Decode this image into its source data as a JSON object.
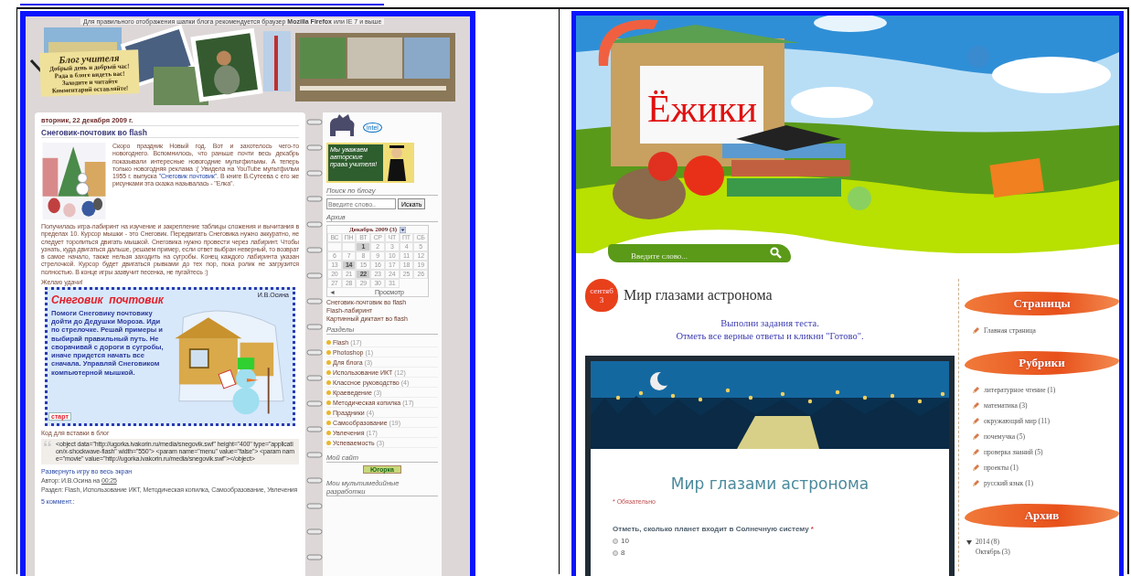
{
  "left_blog": {
    "header": {
      "notice": "Для правильного отображения шапки блога рекомендуется браузер **Mozilla Firefox** или IE 7 и выше",
      "note_title": "Блог учителя",
      "note_lines": [
        "Добрый день и добрый час!",
        "Рада в блоге видеть вас!",
        "Заходите и читайте",
        "Комментарий оставляйте!"
      ]
    },
    "post": {
      "date": "вторник, 22 декабря 2009 г.",
      "title": "Снеговик-почтовик во flash",
      "paragraphs": [
        [
          {
            "kind": "text",
            "text": "Скоро праздник Новый год. Вот и захотелось чего-то новогоднего. Вспомнилось, что раньше почти весь декабрь показывали интересные новогодние мультфильмы. А теперь только новогодняя реклама :( Увидела на YouTube мультфильм 1955 г. выпуска "
          },
          {
            "kind": "link",
            "text": "\"Снеговик почтовик\""
          },
          {
            "kind": "text",
            "text": ". В книге В.Сутеева с его же рисунками эта сказка называлась - \"Елка\"."
          }
        ],
        [
          {
            "kind": "text",
            "text": "Получилась игра-лабиринт на изучение и закрепление таблицы сложения и вычитания в пределах 10. Курсор мышки - это Снеговик. Передвигать Снеговика нужно аккуратно, не следует торопиться двигать мышкой. Снеговика нужно провести через лабиринт. Чтобы узнать, куда двигаться дальше, решаем пример, если ответ выбран неверный, то возврат в самое начало, также нельзя заходить на сугробы. Конец каждого лабиринта указан стрелочкой. Курсор будет двигаться рывками до тех пор, пока ролик не загрузится полностью. В конце игры зазвучит песенка, не пугайтесь :)"
          }
        ]
      ],
      "wish": "Желаю удачи!",
      "game": {
        "author": "И.В.Осина",
        "title": "Снеговик  почтовик",
        "text": "Помоги Снеговику почтовику дойти до Дедушки Мороза. Иди по стрелочке. Решай примеры и выбирай правильный путь. Не сворачивай с дороги в сугробы, иначе придется начать все сначала. Управляй Снеговиком компьютерной мышкой.",
        "start_button": "старт"
      },
      "embed_label": "Код для вставки в блог",
      "embed_code": "<object data=\"http://ugorka.ivakorin.ru/media/snegovik.swf\" height=\"400\" type=\"application/x-shockwave-flash\" width=\"550\"> <param name=\"menu\" value=\"false\"> <param name=\"movie\" value=\"http://ugorka.ivakorin.ru/media/snegovik.swf\"></object>",
      "fullscreen_link": "Развернуть игру во весь экран",
      "author_line": "Автор: И.В.Осина на",
      "author_time": "00:25",
      "labels_line": "Раздел: Flash, Использование ИКТ, Методическая копилка, Самообразование, Увлечения",
      "comments": "5 коммент.:"
    },
    "sidebar": {
      "partner_logo": "intel",
      "chalkboard": "Мы уважаем авторские права учителя!",
      "search": {
        "title": "Поиск по блогу",
        "placeholder": "Введите слово..",
        "button": "Искать"
      },
      "archive": {
        "title": "Архив",
        "month": "Декабрь 2009 (3)",
        "weekdays": [
          "ВС",
          "ПН",
          "ВТ",
          "СР",
          "ЧТ",
          "ПТ",
          "СБ"
        ],
        "days": [
          {
            "kind": "blank"
          },
          {
            "kind": "blank"
          },
          {
            "kind": "day",
            "label": "1",
            "has_post": true
          },
          {
            "kind": "day",
            "label": "2",
            "has_post": false
          },
          {
            "kind": "day",
            "label": "3",
            "has_post": false
          },
          {
            "kind": "day",
            "label": "4",
            "has_post": false
          },
          {
            "kind": "day",
            "label": "5",
            "has_post": false
          },
          {
            "kind": "day",
            "label": "6",
            "has_post": false
          },
          {
            "kind": "day",
            "label": "7",
            "has_post": false
          },
          {
            "kind": "day",
            "label": "8",
            "has_post": false
          },
          {
            "kind": "day",
            "label": "9",
            "has_post": false
          },
          {
            "kind": "day",
            "label": "10",
            "has_post": false
          },
          {
            "kind": "day",
            "label": "11",
            "has_post": false
          },
          {
            "kind": "day",
            "label": "12",
            "has_post": false
          },
          {
            "kind": "day",
            "label": "13",
            "has_post": false
          },
          {
            "kind": "day",
            "label": "14",
            "has_post": true
          },
          {
            "kind": "day",
            "label": "15",
            "has_post": false
          },
          {
            "kind": "day",
            "label": "16",
            "has_post": false
          },
          {
            "kind": "day",
            "label": "17",
            "has_post": false
          },
          {
            "kind": "day",
            "label": "18",
            "has_post": false
          },
          {
            "kind": "day",
            "label": "19",
            "has_post": false
          },
          {
            "kind": "day",
            "label": "20",
            "has_post": false
          },
          {
            "kind": "day",
            "label": "21",
            "has_post": false
          },
          {
            "kind": "day",
            "label": "22",
            "has_post": true
          },
          {
            "kind": "day",
            "label": "23",
            "has_post": false
          },
          {
            "kind": "day",
            "label": "24",
            "has_post": false
          },
          {
            "kind": "day",
            "label": "25",
            "has_post": false
          },
          {
            "kind": "day",
            "label": "26",
            "has_post": false
          },
          {
            "kind": "day",
            "label": "27",
            "has_post": false
          },
          {
            "kind": "day",
            "label": "28",
            "has_post": false
          },
          {
            "kind": "day",
            "label": "29",
            "has_post": false
          },
          {
            "kind": "day",
            "label": "30",
            "has_post": false
          },
          {
            "kind": "day",
            "label": "31",
            "has_post": false
          }
        ],
        "prev": "◄",
        "view": "Просмотр",
        "posts": [
          "Снеговик-почтовик во flash",
          "Flash-лабиринт",
          "Картинный диктант во flash"
        ]
      },
      "sections": {
        "title": "Разделы",
        "items": [
          {
            "label": "Flash",
            "count": "(17)"
          },
          {
            "label": "Photoshop",
            "count": "(1)"
          },
          {
            "label": "Для блога",
            "count": "(3)"
          },
          {
            "label": "Использование ИКТ",
            "count": "(12)"
          },
          {
            "label": "Классное руководство",
            "count": "(4)"
          },
          {
            "label": "Краеведение",
            "count": "(3)"
          },
          {
            "label": "Методическая копилка",
            "count": "(17)"
          },
          {
            "label": "Праздники",
            "count": "(4)"
          },
          {
            "label": "Самообразование",
            "count": "(19)"
          },
          {
            "label": "Увлечения",
            "count": "(17)"
          },
          {
            "label": "Успеваемость",
            "count": "(3)"
          }
        ]
      },
      "my_site": {
        "title": "Мой сайт",
        "badge": "Югорка"
      },
      "multimedia_title": "Мои мультимедийные разработки"
    }
  },
  "right_blog": {
    "header": {
      "title": "Ёжики"
    },
    "search": {
      "placeholder": "Введите слово..."
    },
    "post": {
      "date_month": "сентяб",
      "date_day": "3",
      "title": "Мир глазами астронома",
      "intro": [
        "Выполни задания теста.",
        "Отметь все верные ответы и кликни \"Готово\"."
      ],
      "form": {
        "title": "Мир глазами астронома",
        "required_note": "* Обязательно",
        "question": "Отметь, сколько планет входит в Солнечную систему",
        "required_mark": "*",
        "options": [
          {
            "label": "10",
            "selected": false
          },
          {
            "label": "8",
            "selected": false
          }
        ]
      }
    },
    "sidebar": {
      "pages": {
        "title": "Страницы",
        "items": [
          "Главная страница"
        ]
      },
      "categories": {
        "title": "Рубрики",
        "items": [
          "литературное чтение (1)",
          "математика (3)",
          "окружающий мир (11)",
          "почемучка (5)",
          "проверка знаний (5)",
          "проекты (1)",
          "русский язык (1)"
        ]
      },
      "archive": {
        "title": "Архив",
        "years": [
          {
            "label": "2014 (8)",
            "expanded": true,
            "children": [
              {
                "label": "Октябрь (3)"
              }
            ]
          }
        ]
      }
    }
  }
}
